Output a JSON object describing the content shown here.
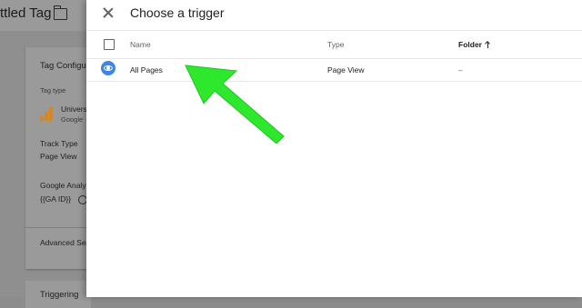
{
  "background": {
    "tag_title": "ttled Tag",
    "card": {
      "heading": "Tag Configur",
      "tag_type_label": "Tag type",
      "tag_type_name": "Univers",
      "tag_type_sub": "Google",
      "track_type_label": "Track Type",
      "track_type_value": "Page View",
      "ga_label": "Google Analy",
      "ga_value": "{{GA ID}}",
      "advanced": "Advanced Se"
    },
    "triggering": "Triggering"
  },
  "panel": {
    "title": "Choose a trigger",
    "columns": {
      "name": "Name",
      "type": "Type",
      "folder": "Folder"
    },
    "rows": [
      {
        "name": "All Pages",
        "type": "Page View",
        "folder": "–"
      }
    ]
  },
  "colors": {
    "accent_blue": "#3f85e3",
    "annotation_green": "#2ee82e",
    "overlay_gray": "#8f8f8f"
  },
  "icons": [
    "folder-icon",
    "close-icon",
    "sort-ascending-icon",
    "eye-icon",
    "analytics-icon",
    "info-icon"
  ]
}
